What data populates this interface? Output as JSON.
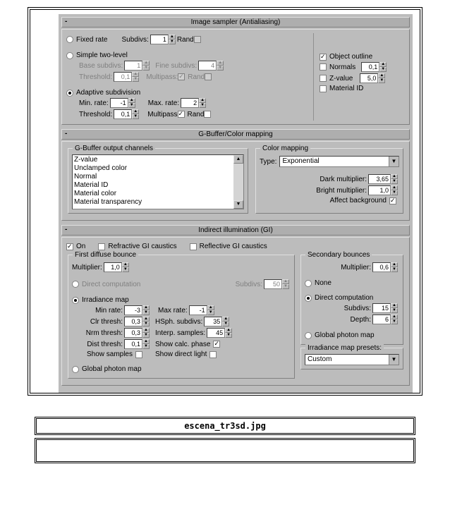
{
  "caption": "escena_tr3sd.jpg",
  "rollups": {
    "imageSampler": {
      "title": "Image sampler (Antialiasing)",
      "fixedRate": {
        "label": "Fixed rate",
        "subdivsLabel": "Subdivs:",
        "subdivs": "1",
        "randLabel": "Rand"
      },
      "simpleTwoLevel": {
        "label": "Simple two-level",
        "baseSubdivsLabel": "Base subdivs:",
        "baseSubdivs": "1",
        "fineSubdivsLabel": "Fine subdivs:",
        "fineSubdivs": "4",
        "thresholdLabel": "Threshold:",
        "threshold": "0,1",
        "multipassLabel": "Multipass:",
        "randLabel": "Rand"
      },
      "adaptive": {
        "label": "Adaptive subdivision",
        "minRateLabel": "Min. rate:",
        "minRate": "-1",
        "maxRateLabel": "Max. rate:",
        "maxRate": "2",
        "thresholdLabel": "Threshold:",
        "threshold": "0,1",
        "multipassLabel": "Multipass",
        "randLabel": "Rand"
      },
      "right": {
        "objectOutline": "Object outline",
        "normals": "Normals",
        "normalsVal": "0,1",
        "zvalue": "Z-value",
        "zvalueVal": "5,0",
        "materialId": "Material ID"
      }
    },
    "gbuffer": {
      "title": "G-Buffer/Color mapping",
      "channelsTitle": "G-Buffer output channels",
      "channels": [
        "Z-value",
        "Unclamped color",
        "Normal",
        "Material ID",
        "Material color",
        "Material transparency"
      ],
      "mappingTitle": "Color mapping",
      "typeLabel": "Type:",
      "type": "Exponential",
      "darkLabel": "Dark multiplier:",
      "dark": "3,65",
      "brightLabel": "Bright multiplier:",
      "bright": "1,0",
      "affectBg": "Affect background"
    },
    "gi": {
      "title": "Indirect illumination (GI)",
      "onLabel": "On",
      "refractiveLabel": "Refractive GI caustics",
      "reflectiveLabel": "Reflective GI caustics",
      "first": {
        "title": "First diffuse bounce",
        "multiplierLabel": "Multiplier:",
        "multiplier": "1,0",
        "directLabel": "Direct computation",
        "subdivsLabel": "Subdivs:",
        "subdivs": "50",
        "irrLabel": "Irradiance map",
        "minRateLabel": "Min rate:",
        "minRate": "-3",
        "maxRateLabel": "Max rate:",
        "maxRate": "-1",
        "clrLabel": "Clr thresh:",
        "clr": "0,3",
        "hsphLabel": "HSph. subdivs:",
        "hsph": "35",
        "nrmLabel": "Nrm thresh:",
        "nrm": "0,3",
        "interpLabel": "Interp. samples:",
        "interp": "45",
        "distLabel": "Dist thresh:",
        "dist": "0,1",
        "showCalcLabel": "Show calc. phase",
        "showSamplesLabel": "Show samples",
        "showDirectLabel": "Show direct light",
        "globalPhotonLabel": "Global photon map"
      },
      "second": {
        "title": "Secondary bounces",
        "multiplierLabel": "Multiplier:",
        "multiplier": "0,6",
        "noneLabel": "None",
        "directLabel": "Direct computation",
        "subdivsLabel": "Subdivs:",
        "subdivs": "15",
        "depthLabel": "Depth:",
        "depth": "6",
        "globalPhotonLabel": "Global photon map",
        "presetsLabel": "Irradiance map presets:",
        "preset": "Custom"
      }
    }
  }
}
